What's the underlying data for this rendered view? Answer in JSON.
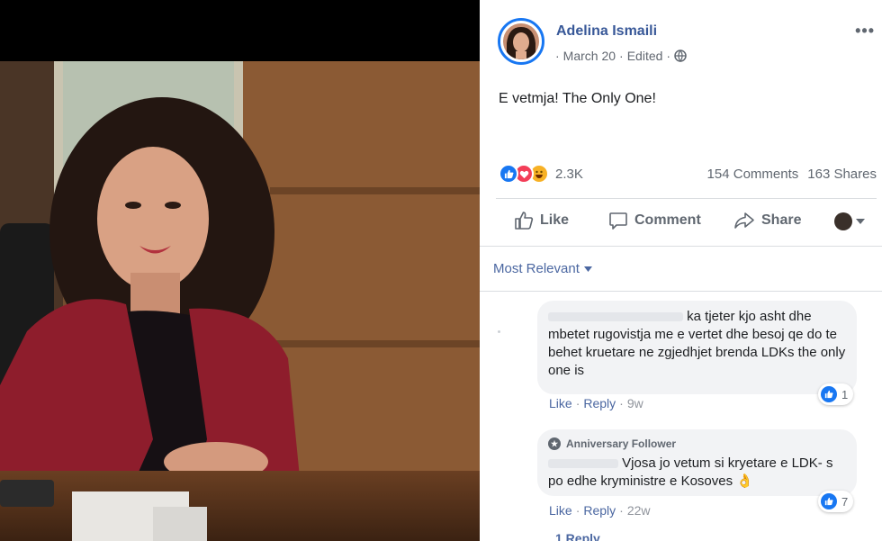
{
  "post": {
    "author": "Adelina Ismaili",
    "date": "March 20",
    "edited": "Edited",
    "separator": "·",
    "text": "E vetmja! The Only One!",
    "more_menu": "•••",
    "globe_icon": "globe-icon"
  },
  "reactions": {
    "count": "2.3K",
    "comments": "154 Comments",
    "shares": "163 Shares",
    "icons": [
      "like-reaction-icon",
      "love-reaction-icon",
      "haha-reaction-icon"
    ]
  },
  "actions": {
    "like": "Like",
    "comment": "Comment",
    "share": "Share"
  },
  "comments_filter": "Most Relevant",
  "comments": [
    {
      "text_line1": "ka tjeter kjo asht dhe",
      "text_rest": "mbetet rugovistja me e vertet dhe besoj qe do te behet kruetare ne zgjedhjet brenda LDKs the only one is",
      "reaction_count": "1",
      "like": "Like",
      "reply": "Reply",
      "time": "9w"
    },
    {
      "badge": "Anniversary Follower",
      "text_line1": "Vjosa jo vetum si kryetare e LDK-",
      "text_rest": "s po edhe kryministre e Kosoves 👌",
      "reaction_count": "7",
      "like": "Like",
      "reply": "Reply",
      "time": "22w"
    }
  ],
  "replies_link": "1 Reply",
  "colors": {
    "brand_blue": "#1877f2",
    "link_blue": "#385898",
    "muted": "#606770",
    "bubble": "#f2f3f5"
  }
}
